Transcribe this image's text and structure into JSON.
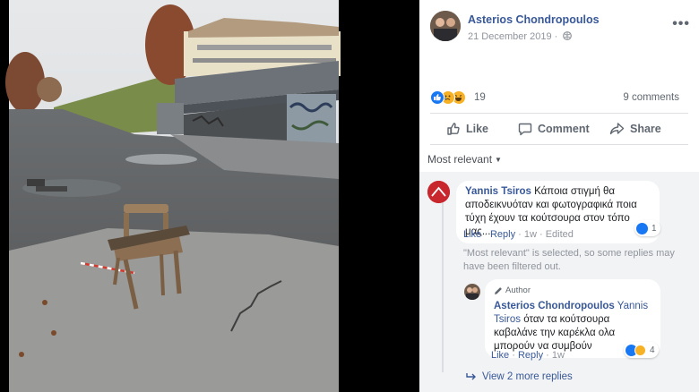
{
  "post": {
    "author": "Asterios Chondropoulos",
    "date": "21 December 2019 · ",
    "more_icon": "ellipsis-icon",
    "reaction_count": "19",
    "comments_count": "9 comments",
    "reaction_icons": [
      "like",
      "sad",
      "haha"
    ]
  },
  "actions": {
    "like": "Like",
    "comment": "Comment",
    "share": "Share"
  },
  "filter": {
    "label": "Most relevant"
  },
  "comments": [
    {
      "author": "Yannis Tsiros",
      "text": " Κάποια στιγμή θα αποδεικνυόταν και φωτογραφικά ποια τύχη έχουν τα κούτσουρα στον τόπο μας...",
      "like": "Like",
      "reply": "Reply",
      "time": "1w",
      "edited": "Edited",
      "reaction_count": "1"
    }
  ],
  "notice": "\"Most relevant\" is selected, so some replies may have been filtered out.",
  "reply": {
    "tag": "Author",
    "author": "Asterios Chondropoulos",
    "mention": " Yannis Tsiros",
    "text": " όταν τα κούτσουρα καβαλάνε την καρέκλα ολα μπορούν να συμβούν",
    "like": "Like",
    "reply": "Reply",
    "time": "1w",
    "reaction_count": "4"
  },
  "view_more": "View 2 more replies",
  "colors": {
    "link": "#385898",
    "like_blue": "#1877f2",
    "haha_yellow": "#f7b125"
  }
}
